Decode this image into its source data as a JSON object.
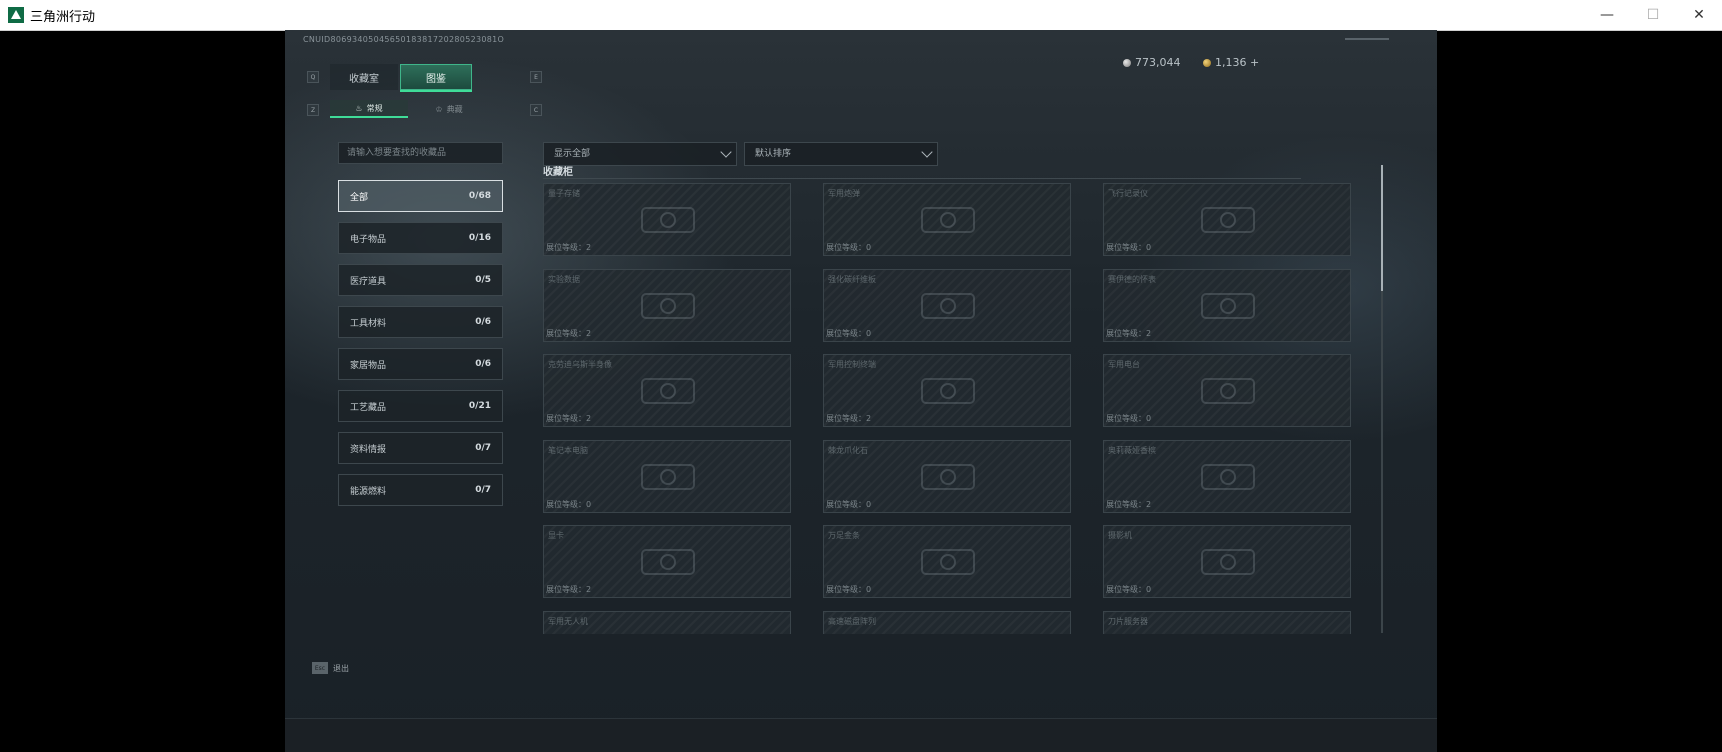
{
  "window": {
    "title": "三角洲行动",
    "minimize_glyph": "—",
    "maximize_glyph": "☐",
    "close_glyph": "✕"
  },
  "header": {
    "uid": "CNUID8069340504565018381720280523081O",
    "currency_silver": "773,044",
    "currency_gold": "1,136 +"
  },
  "tabs": {
    "left_key": "Q",
    "right_key": "E",
    "items": [
      {
        "label": "收藏室",
        "active": false
      },
      {
        "label": "图鉴",
        "active": true
      }
    ]
  },
  "subtabs": {
    "left_key": "Z",
    "right_key": "C",
    "items": [
      {
        "label": "常规",
        "icon": "flame-icon",
        "glyph": "♨",
        "active": true
      },
      {
        "label": "典藏",
        "icon": "crown-icon",
        "glyph": "♔",
        "active": false
      }
    ]
  },
  "search": {
    "placeholder": "请输入想要查找的收藏品"
  },
  "filters": {
    "show": "显示全部",
    "sort": "默认排序"
  },
  "categories": [
    {
      "label": "全部",
      "count": "0/68",
      "active": true
    },
    {
      "label": "电子物品",
      "count": "0/16",
      "active": false
    },
    {
      "label": "医疗道具",
      "count": "0/5",
      "active": false
    },
    {
      "label": "工具材料",
      "count": "0/6",
      "active": false
    },
    {
      "label": "家居物品",
      "count": "0/6",
      "active": false
    },
    {
      "label": "工艺藏品",
      "count": "0/21",
      "active": false
    },
    {
      "label": "资料情报",
      "count": "0/7",
      "active": false
    },
    {
      "label": "能源燃料",
      "count": "0/7",
      "active": false
    }
  ],
  "cabinet": {
    "title": "收藏柜",
    "items": [
      {
        "name": "量子存储",
        "level": "展位等级：2"
      },
      {
        "name": "军用炮弹",
        "level": "展位等级：0"
      },
      {
        "name": "飞行记录仪",
        "level": "展位等级：0"
      },
      {
        "name": "实验数据",
        "level": "展位等级：2"
      },
      {
        "name": "强化碳纤维板",
        "level": "展位等级：0"
      },
      {
        "name": "赛伊德的怀表",
        "level": "展位等级：2"
      },
      {
        "name": "克劳迪乌斯半身像",
        "level": "展位等级：2"
      },
      {
        "name": "军用控制终端",
        "level": "展位等级：2"
      },
      {
        "name": "军用电台",
        "level": "展位等级：0"
      },
      {
        "name": "笔记本电脑",
        "level": "展位等级：0"
      },
      {
        "name": "棘龙爪化石",
        "level": "展位等级：0"
      },
      {
        "name": "奥莉薇娅香槟",
        "level": "展位等级：2"
      },
      {
        "name": "显卡",
        "level": "展位等级：2"
      },
      {
        "name": "万足金条",
        "level": "展位等级：0"
      },
      {
        "name": "摄影机",
        "level": "展位等级：0"
      },
      {
        "name": "军用无人机",
        "level": ""
      },
      {
        "name": "高速磁盘阵列",
        "level": ""
      },
      {
        "name": "刀片服务器",
        "level": ""
      }
    ]
  },
  "footer": {
    "esc_key": "Esc",
    "esc_label": "退出"
  }
}
